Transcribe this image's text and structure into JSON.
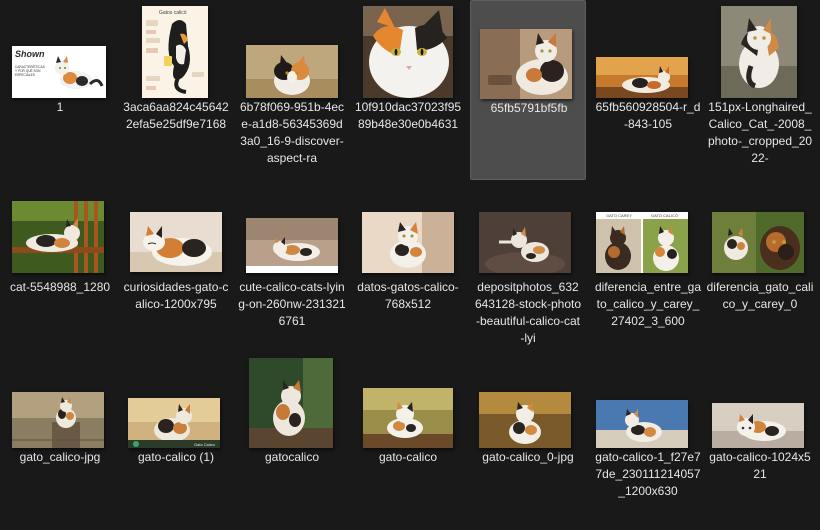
{
  "files": [
    {
      "name": "1",
      "selected": false,
      "thumb": "shown-article-cover",
      "overlay": [
        "Shown",
        "CARACTERÍSTICAS",
        "Y POR QUÉ SON",
        "ESPECIALES"
      ]
    },
    {
      "name": "3aca6aa824c456422efa5e25df9e7168",
      "selected": false,
      "thumb": "infographic",
      "overlay": [
        "Gatos calicó"
      ]
    },
    {
      "name": "6b78f069-951b-4ece-a1d8-56345369d3a0_16-9-discover-aspect-ra",
      "selected": false,
      "thumb": "cat-photo",
      "overlay": []
    },
    {
      "name": "10f910dac37023f9589b48e30e0b4631",
      "selected": false,
      "thumb": "cat-photo",
      "overlay": []
    },
    {
      "name": "65fb5791bf5fb",
      "selected": true,
      "thumb": "cat-photo",
      "overlay": []
    },
    {
      "name": "65fb560928504-r_d-843-105",
      "selected": false,
      "thumb": "cat-photo",
      "overlay": []
    },
    {
      "name": "151px-Longhaired_Calico_Cat_-2008_photo-_cropped_2022-",
      "selected": false,
      "thumb": "cat-photo",
      "overlay": []
    },
    {
      "name": "cat-5548988_1280",
      "selected": false,
      "thumb": "cat-photo",
      "overlay": []
    },
    {
      "name": "curiosidades-gato-calico-1200x795",
      "selected": false,
      "thumb": "cat-photo",
      "overlay": []
    },
    {
      "name": "cute-calico-cats-lying-on-260nw-2313216761",
      "selected": false,
      "thumb": "cat-photo",
      "overlay": []
    },
    {
      "name": "datos-gatos-calico-768x512",
      "selected": false,
      "thumb": "cat-photo",
      "overlay": []
    },
    {
      "name": "depositphotos_632643128-stock-photo-beautiful-calico-cat-lyi",
      "selected": false,
      "thumb": "cat-photo",
      "overlay": []
    },
    {
      "name": "diferencia_entre_gato_calico_y_carey_27402_3_600",
      "selected": false,
      "thumb": "comparison",
      "overlay": [
        "GATO CAREY",
        "GATO CALICÓ"
      ]
    },
    {
      "name": "diferencia_gato_calico_y_carey_0",
      "selected": false,
      "thumb": "cat-photo",
      "overlay": []
    },
    {
      "name": "gato_calico-jpg",
      "selected": false,
      "thumb": "cat-photo",
      "overlay": []
    },
    {
      "name": "gato-calico (1)",
      "selected": false,
      "thumb": "cat-photo-banner",
      "overlay": [
        "Gato Calico"
      ]
    },
    {
      "name": "gatocalico",
      "selected": false,
      "thumb": "cat-photo",
      "overlay": []
    },
    {
      "name": "gato-calico",
      "selected": false,
      "thumb": "cat-photo",
      "overlay": []
    },
    {
      "name": "gato-calico_0-jpg",
      "selected": false,
      "thumb": "cat-photo",
      "overlay": []
    },
    {
      "name": "gato-calico-1_f27e77de_230111214057_1200x630",
      "selected": false,
      "thumb": "cat-photo",
      "overlay": []
    },
    {
      "name": "gato-calico-1024x521",
      "selected": false,
      "thumb": "cat-photo",
      "overlay": []
    }
  ],
  "colors": {
    "background": "#191919",
    "selection": "#4d4d4d",
    "label": "#e6e6e6"
  }
}
